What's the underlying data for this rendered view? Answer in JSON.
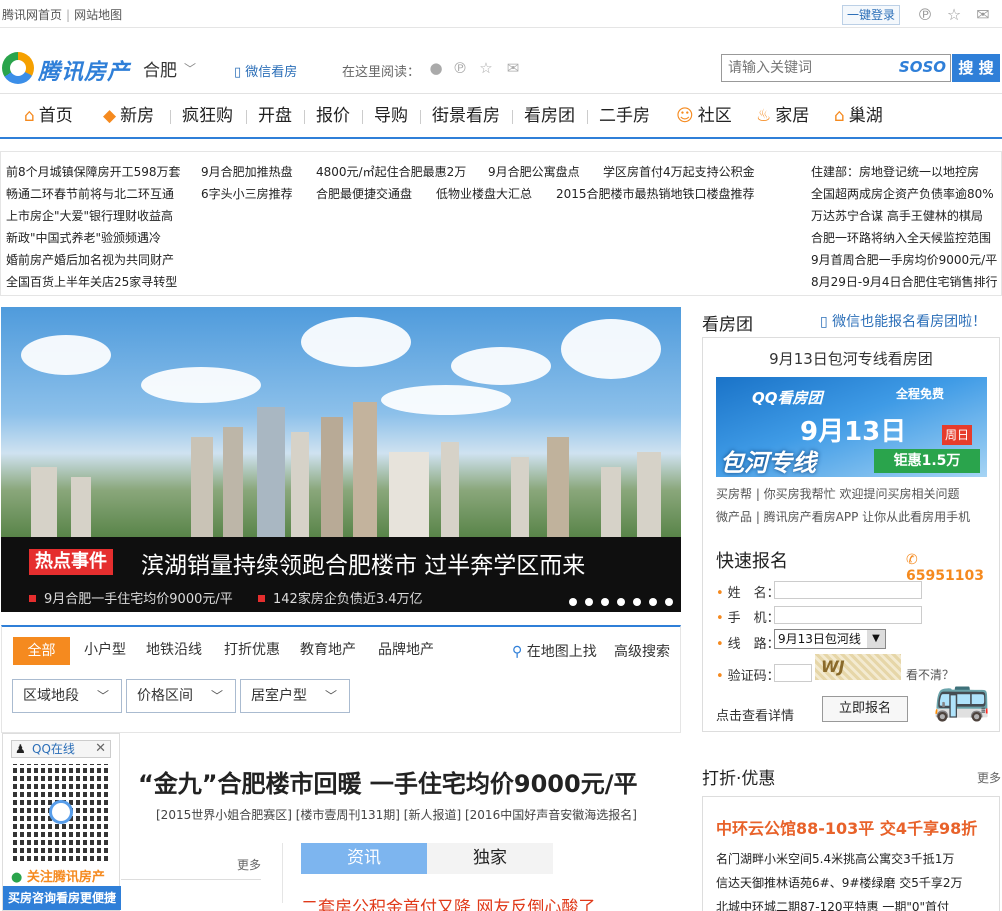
{
  "topbar": {
    "links": [
      "腾讯网首页",
      "网站地图"
    ],
    "login_label": "一键登录",
    "icons": [
      "pinterest-icon",
      "star-icon"
    ]
  },
  "header": {
    "logo_text": "腾讯房产",
    "city": "合肥",
    "wechat_read": "微信看房",
    "read_here": "在这里阅读：",
    "read_icons": [
      "wechat-icon",
      "pinterest-icon",
      "star-icon",
      "mail-icon"
    ],
    "search_placeholder": "请输入关键词",
    "soso_logo": "SOSO",
    "search_button": "搜 搜"
  },
  "nav": {
    "items": [
      {
        "label": "首页",
        "icon": "home-icon"
      },
      {
        "label": "新房",
        "icon": "tag-icon"
      },
      {
        "label": "疯狂购",
        "icon": ""
      },
      {
        "label": "开盘",
        "icon": ""
      },
      {
        "label": "报价",
        "icon": ""
      },
      {
        "label": "导购",
        "icon": ""
      },
      {
        "label": "街景看房",
        "icon": ""
      },
      {
        "label": "看房团",
        "icon": ""
      },
      {
        "label": "二手房",
        "icon": ""
      },
      {
        "label": "社区",
        "icon": "chat-icon"
      },
      {
        "label": "家居",
        "icon": "lamp-icon"
      },
      {
        "label": "巢湖",
        "icon": "home-icon"
      }
    ]
  },
  "headlines": {
    "col1": [
      "前8个月城镇保障房开工598万套",
      "畅通二环春节前将与北二环互通",
      "上市房企\"大爱\"银行理财收益高",
      "新政\"中国式养老\"验颁频遇冷",
      "婚前房产婚后加名视为共同财产",
      "全国百货上半年关店25家寻转型"
    ],
    "row1": [
      "9月合肥加推热盘",
      "4800元/㎡起住合肥最惠2万",
      "9月合肥公寓盘点",
      "学区房首付4万起支持公积金"
    ],
    "row2": [
      "6字头小三房推荐",
      "合肥最便捷交通盘",
      "低物业楼盘大汇总",
      "2015合肥楼市最热销地铁口楼盘推荐"
    ],
    "col_right": [
      "住建部：房地登记统一以地控房",
      "全国超两成房企资产负债率逾80%",
      "万达苏宁合谋 高手王健林的棋局",
      "合肥一环路将纳入全天候监控范围",
      "9月首周合肥一手房均价9000元/平",
      "8月29日-9月4日合肥住宅销售排行"
    ]
  },
  "banner": {
    "hot_tag": "热点事件",
    "title": "滨湖销量持续领跑合肥楼市 过半奔学区而来",
    "subs": [
      "9月合肥一手住宅均价9000元/平",
      "142家房企负债近3.4万亿"
    ],
    "dot_count": 7
  },
  "filters": {
    "tabs": [
      "全部",
      "小户型",
      "地铁沿线",
      "打折优惠",
      "教育地产",
      "品牌地产"
    ],
    "map_find": "在地图上找",
    "adv_search": "高级搜索",
    "selects": [
      "区域地段",
      "价格区间",
      "居室户型"
    ]
  },
  "qq_float": {
    "head": "QQ在线",
    "follow": "关注腾讯房产",
    "bottom": "买房咨询看房更便捷"
  },
  "main": {
    "headline": "“金九”合肥楼市回暖 一手住宅均价9000元/平",
    "sub_links": "[2015世界小姐合肥赛区] [楼市壹周刊131期] [新人报道] [2016中国好声音安徽海选报名]",
    "more": "更多",
    "tabs": [
      "资讯",
      "独家"
    ],
    "partial_news": "二套房公积金首付又降 网友反倒心酸了"
  },
  "kanfangtuan": {
    "title": "看房团",
    "wechat": "微信也能报名看房团啦！",
    "subtitle": "9月13日包河专线看房团",
    "ad": {
      "logo": "QQ看房团",
      "free": "全程免费",
      "date": "9月13日",
      "week": "周日",
      "line": "包河专线",
      "distance": "钜惠1.5万"
    },
    "text1": "买房帮 | 你买房我帮忙 欢迎提问买房相关问题",
    "text2": "微产品 | 腾讯房产看房APP 让你从此看房用手机",
    "quick_reg": "快速报名",
    "phone": "65951103",
    "labels": [
      "姓　名：",
      "手　机：",
      "线　路：",
      "验证码："
    ],
    "route_value": "9月13日包河线",
    "captcha_text": "WJ",
    "not_clear": "看不清？",
    "detail": "点击查看详情",
    "signup": "立即报名"
  },
  "discounts": {
    "title": "打折·优惠",
    "more": "更多",
    "main": "中环云公馆88-103平 交4千享98折",
    "items": [
      "名门湖畔小米空间5.4米挑高公寓交3千抵1万",
      "信达天御推林语苑6#、9#楼绿磨 交5千享2万",
      "北城中环城二期87-120平特惠 一期\"0\"首付"
    ]
  },
  "colors": {
    "brand_blue": "#2f7fd8",
    "accent_orange": "#f58a1f",
    "hot_red": "#e52e2e"
  }
}
